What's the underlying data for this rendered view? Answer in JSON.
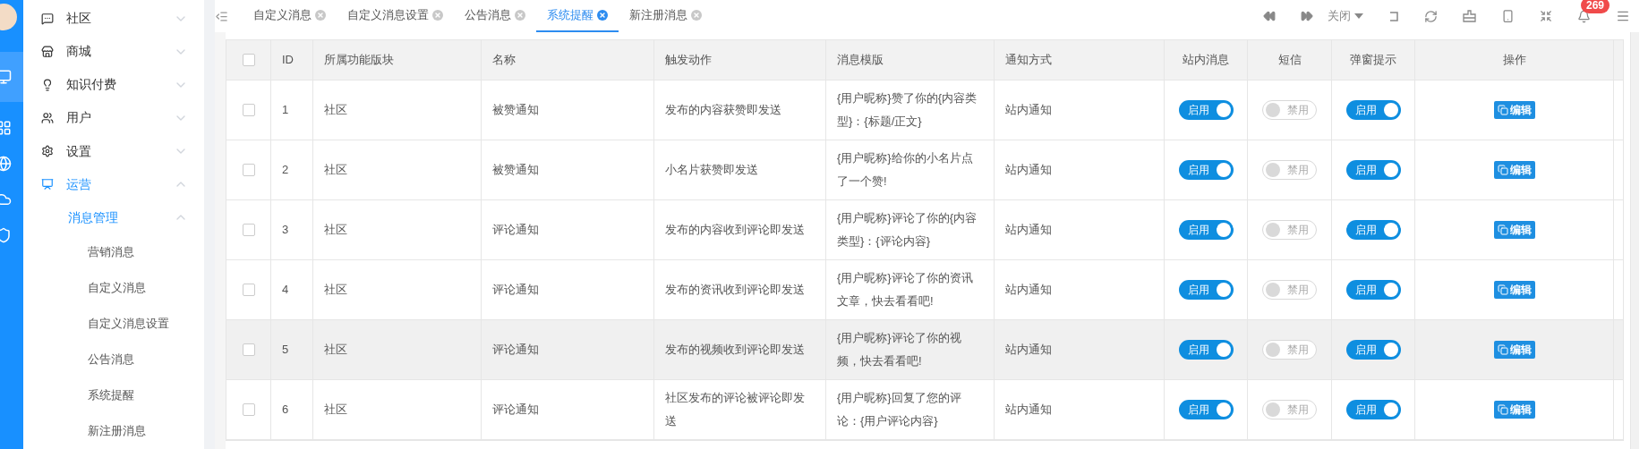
{
  "sidebar": {
    "items": [
      {
        "label": "社区",
        "expanded": false,
        "selected": false
      },
      {
        "label": "商城",
        "expanded": false,
        "selected": false
      },
      {
        "label": "知识付费",
        "expanded": false,
        "selected": false
      },
      {
        "label": "用户",
        "expanded": false,
        "selected": false
      },
      {
        "label": "设置",
        "expanded": false,
        "selected": false
      },
      {
        "label": "运营",
        "expanded": true,
        "selected": true,
        "children": [
          {
            "label": "消息管理",
            "expanded": true,
            "selected": true,
            "children": [
              {
                "label": "营销消息",
                "selected": false
              },
              {
                "label": "自定义消息",
                "selected": false
              },
              {
                "label": "自定义消息设置",
                "selected": false
              },
              {
                "label": "公告消息",
                "selected": false
              },
              {
                "label": "系统提醒",
                "selected": false
              },
              {
                "label": "新注册消息",
                "selected": false
              }
            ]
          }
        ]
      }
    ]
  },
  "tabs": [
    {
      "label": "自定义消息",
      "selected": false
    },
    {
      "label": "自定义消息设置",
      "selected": false
    },
    {
      "label": "公告消息",
      "selected": false
    },
    {
      "label": "系统提醒",
      "selected": true
    },
    {
      "label": "新注册消息",
      "selected": false
    }
  ],
  "toolbar": {
    "close_menu": "关闭",
    "notification_count": "269"
  },
  "table": {
    "select_all_checked": false,
    "columns": [
      "ID",
      "所属功能版块",
      "名称",
      "触发动作",
      "消息模版",
      "通知方式",
      "站内消息",
      "短信",
      "弹窗提示",
      "操作"
    ],
    "rows": [
      {
        "checked": false,
        "highlighted": false,
        "id": "1",
        "module": "社区",
        "name": "被赞通知",
        "action": "发布的内容获赞即发送",
        "template": "{用户昵称}赞了你的{内容类型}：{标题/正文}",
        "method": "站内通知",
        "in_site": {
          "label": "启用",
          "on": true
        },
        "sms": {
          "label": "禁用",
          "on": false
        },
        "popup": {
          "label": "启用",
          "on": true
        },
        "edit": "编辑"
      },
      {
        "checked": false,
        "highlighted": false,
        "id": "2",
        "module": "社区",
        "name": "被赞通知",
        "action": "小名片获赞即发送",
        "template": "{用户昵称}给你的小名片点了一个赞!",
        "method": "站内通知",
        "in_site": {
          "label": "启用",
          "on": true
        },
        "sms": {
          "label": "禁用",
          "on": false
        },
        "popup": {
          "label": "启用",
          "on": true
        },
        "edit": "编辑"
      },
      {
        "checked": false,
        "highlighted": false,
        "id": "3",
        "module": "社区",
        "name": "评论通知",
        "action": "发布的内容收到评论即发送",
        "template": "{用户昵称}评论了你的{内容类型}：{评论内容}",
        "method": "站内通知",
        "in_site": {
          "label": "启用",
          "on": true
        },
        "sms": {
          "label": "禁用",
          "on": false
        },
        "popup": {
          "label": "启用",
          "on": true
        },
        "edit": "编辑"
      },
      {
        "checked": false,
        "highlighted": false,
        "id": "4",
        "module": "社区",
        "name": "评论通知",
        "action": "发布的资讯收到评论即发送",
        "template": "{用户昵称}评论了你的资讯文章，快去看看吧!",
        "method": "站内通知",
        "in_site": {
          "label": "启用",
          "on": true
        },
        "sms": {
          "label": "禁用",
          "on": false
        },
        "popup": {
          "label": "启用",
          "on": true
        },
        "edit": "编辑"
      },
      {
        "checked": false,
        "highlighted": true,
        "id": "5",
        "module": "社区",
        "name": "评论通知",
        "action": "发布的视频收到评论即发送",
        "template": "{用户昵称}评论了你的视频，快去看看吧!",
        "method": "站内通知",
        "in_site": {
          "label": "启用",
          "on": true
        },
        "sms": {
          "label": "禁用",
          "on": false
        },
        "popup": {
          "label": "启用",
          "on": true
        },
        "edit": "编辑"
      },
      {
        "checked": false,
        "highlighted": false,
        "id": "6",
        "module": "社区",
        "name": "评论通知",
        "action": "社区发布的评论被评论即发送",
        "template": "{用户昵称}回复了您的评论：{用户评论内容}",
        "method": "站内通知",
        "in_site": {
          "label": "启用",
          "on": true
        },
        "sms": {
          "label": "禁用",
          "on": false
        },
        "popup": {
          "label": "启用",
          "on": true
        },
        "edit": "编辑"
      }
    ]
  }
}
